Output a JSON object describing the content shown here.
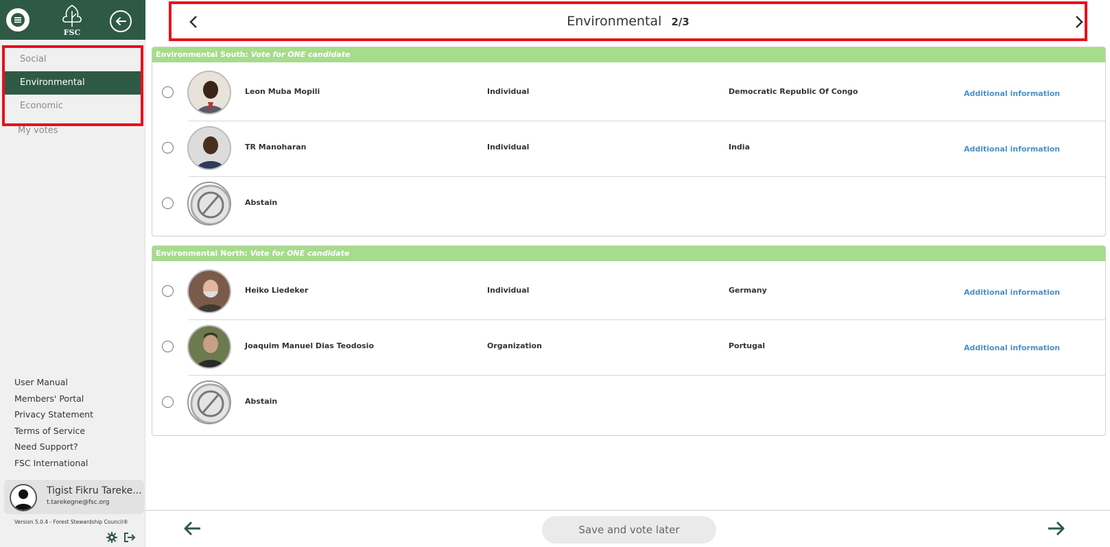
{
  "sidebar": {
    "logo_text": "FSC",
    "nav": [
      {
        "label": "Social"
      },
      {
        "label": "Environmental"
      },
      {
        "label": "Economic"
      }
    ],
    "my_votes": "My votes",
    "links": [
      "User Manual",
      "Members' Portal",
      "Privacy Statement",
      "Terms of Service",
      "Need Support?",
      "FSC International"
    ],
    "user": {
      "name": "Tigist Fikru Tareke...",
      "email": "t.tarekegne@fsc.org"
    },
    "version": "Version 5.0.4 - Forest Stewardship Council®"
  },
  "topbar": {
    "title": "Environmental",
    "page": "2/3"
  },
  "sections": [
    {
      "title": "Environmental South:",
      "instruction": "Vote for ONE candidate",
      "candidates": [
        {
          "name": "Leon Muba Mopili",
          "type": "Individual",
          "country": "Democratic Republic Of Congo",
          "info": "Additional information"
        },
        {
          "name": "TR Manoharan",
          "type": "Individual",
          "country": "India",
          "info": "Additional information"
        },
        {
          "name": "Abstain"
        }
      ]
    },
    {
      "title": "Environmental North:",
      "instruction": "Vote for ONE candidate",
      "candidates": [
        {
          "name": "Heiko Liedeker",
          "type": "Individual",
          "country": "Germany",
          "info": "Additional information"
        },
        {
          "name": "Joaquim Manuel Dias Teodosio",
          "type": "Organization",
          "country": "Portugal",
          "info": "Additional information"
        },
        {
          "name": "Abstain"
        }
      ]
    }
  ],
  "bottombar": {
    "save_label": "Save and vote later"
  },
  "colors": {
    "brand_green": "#2e5a45",
    "section_header": "#a6dc8c",
    "link_blue": "#4a90c8",
    "highlight_red": "#e8101b"
  },
  "icons": [
    "menu-icon",
    "fsc-tree-logo",
    "back-circle-icon",
    "chevron-left-icon",
    "chevron-right-icon",
    "abstain-icon",
    "user-avatar-icon",
    "gear-icon",
    "logout-icon",
    "arrow-left-icon",
    "arrow-right-icon"
  ]
}
